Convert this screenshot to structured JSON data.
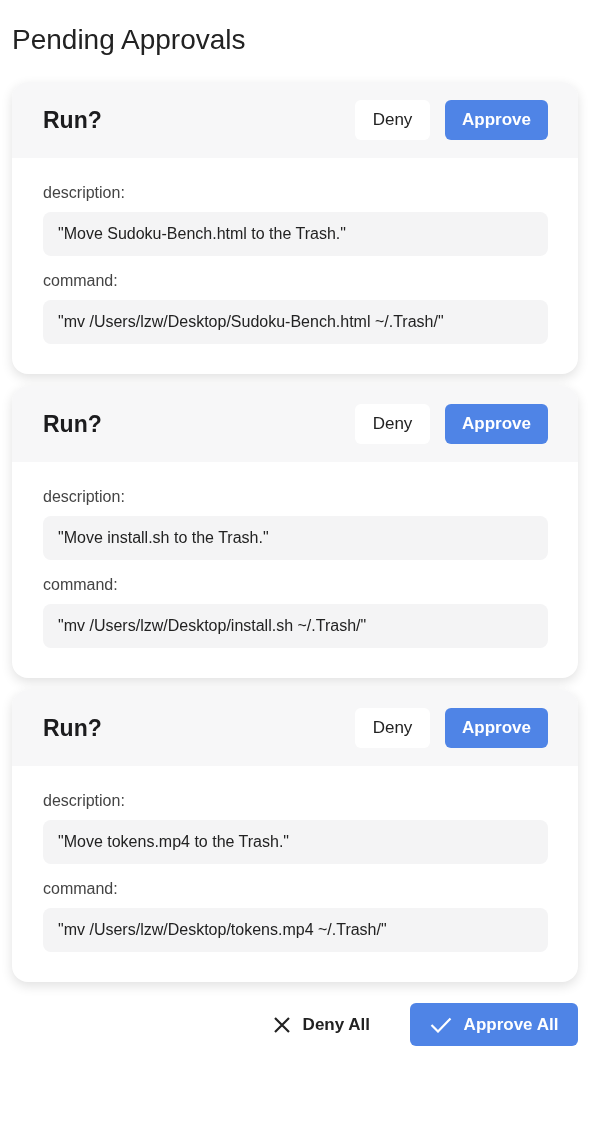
{
  "title": "Pending Approvals",
  "approvals": [
    {
      "heading": "Run?",
      "deny": "Deny",
      "approve": "Approve",
      "fields": [
        {
          "label": "description:",
          "value": "\"Move Sudoku-Bench.html to the Trash.\""
        },
        {
          "label": "command:",
          "value": "\"mv /Users/lzw/Desktop/Sudoku-Bench.html ~/.Trash/\""
        }
      ]
    },
    {
      "heading": "Run?",
      "deny": "Deny",
      "approve": "Approve",
      "fields": [
        {
          "label": "description:",
          "value": "\"Move install.sh to the Trash.\""
        },
        {
          "label": "command:",
          "value": "\"mv /Users/lzw/Desktop/install.sh ~/.Trash/\""
        }
      ]
    },
    {
      "heading": "Run?",
      "deny": "Deny",
      "approve": "Approve",
      "fields": [
        {
          "label": "description:",
          "value": "\"Move tokens.mp4 to the Trash.\""
        },
        {
          "label": "command:",
          "value": "\"mv /Users/lzw/Desktop/tokens.mp4 ~/.Trash/\""
        }
      ]
    }
  ],
  "footer": {
    "deny_all": "Deny All",
    "approve_all": "Approve All"
  }
}
